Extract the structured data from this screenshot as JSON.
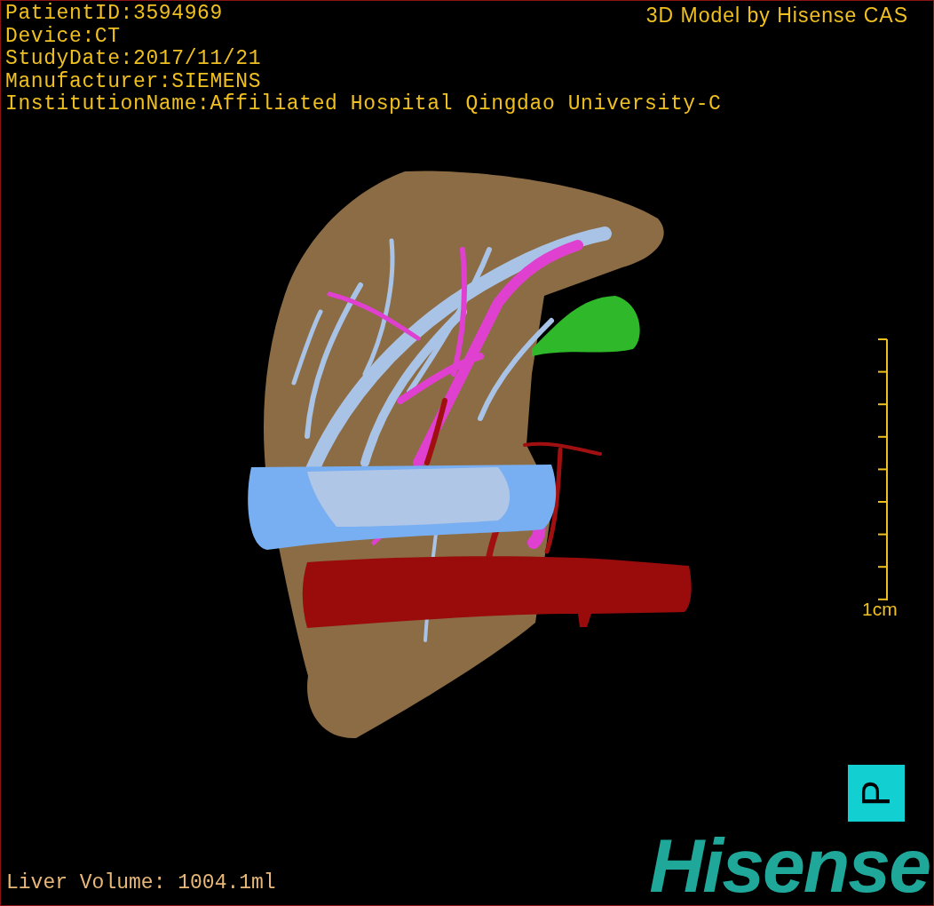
{
  "patient_info": [
    "PatientID:3594969",
    "Device:CT",
    "StudyDate:2017/11/21",
    "Manufacturer:SIEMENS",
    "InstitutionName:Affiliated Hospital Qingdao University-C"
  ],
  "model_credit": "3D Model by Hisense CAS",
  "scale_bar": {
    "label": "1cm"
  },
  "orientation_marker": {
    "label": "P"
  },
  "liver_volume": "Liver Volume: 1004.1ml",
  "logo": {
    "text": "Hisense"
  }
}
